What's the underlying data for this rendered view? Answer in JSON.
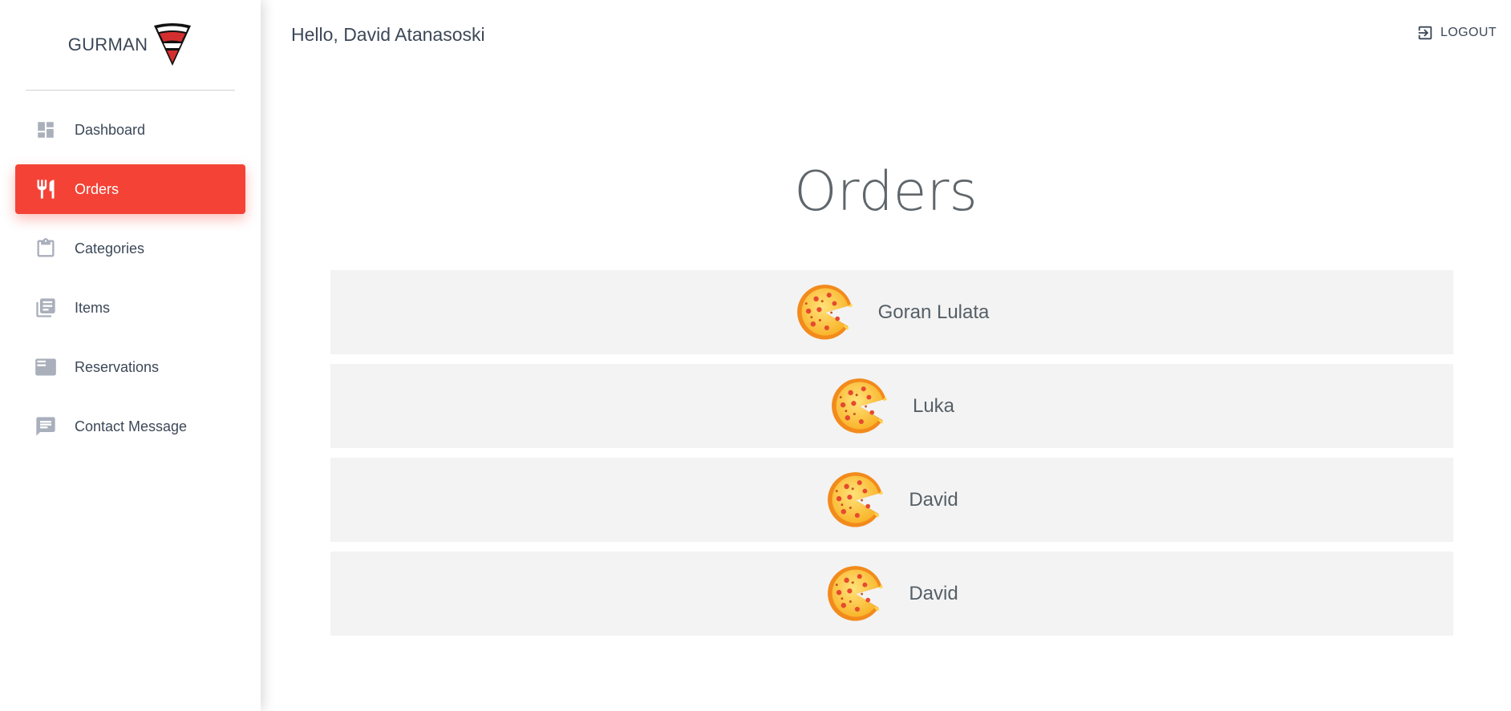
{
  "brand": {
    "name": "GURMAN",
    "logo_icon": "pizza-slice-logo-icon"
  },
  "sidebar": {
    "items": [
      {
        "label": "Dashboard",
        "icon": "dashboard-icon",
        "active": false
      },
      {
        "label": "Orders",
        "icon": "fork-knife-icon",
        "active": true
      },
      {
        "label": "Categories",
        "icon": "clipboard-icon",
        "active": false
      },
      {
        "label": "Items",
        "icon": "library-books-icon",
        "active": false
      },
      {
        "label": "Reservations",
        "icon": "featured-play-list-icon",
        "active": false
      },
      {
        "label": "Contact Message",
        "icon": "chat-icon",
        "active": false
      }
    ]
  },
  "header": {
    "greeting": "Hello, David Atanasoski",
    "logout_label": "LOGOUT"
  },
  "main": {
    "title": "Orders",
    "orders": [
      {
        "name": "Goran Lulata",
        "icon": "pizza-icon"
      },
      {
        "name": "Luka",
        "icon": "pizza-icon"
      },
      {
        "name": "David",
        "icon": "pizza-icon"
      },
      {
        "name": "David",
        "icon": "pizza-icon"
      }
    ]
  },
  "colors": {
    "accent": "#f44336",
    "icon_gray": "#a9afbb",
    "row_bg": "#f3f3f3"
  }
}
